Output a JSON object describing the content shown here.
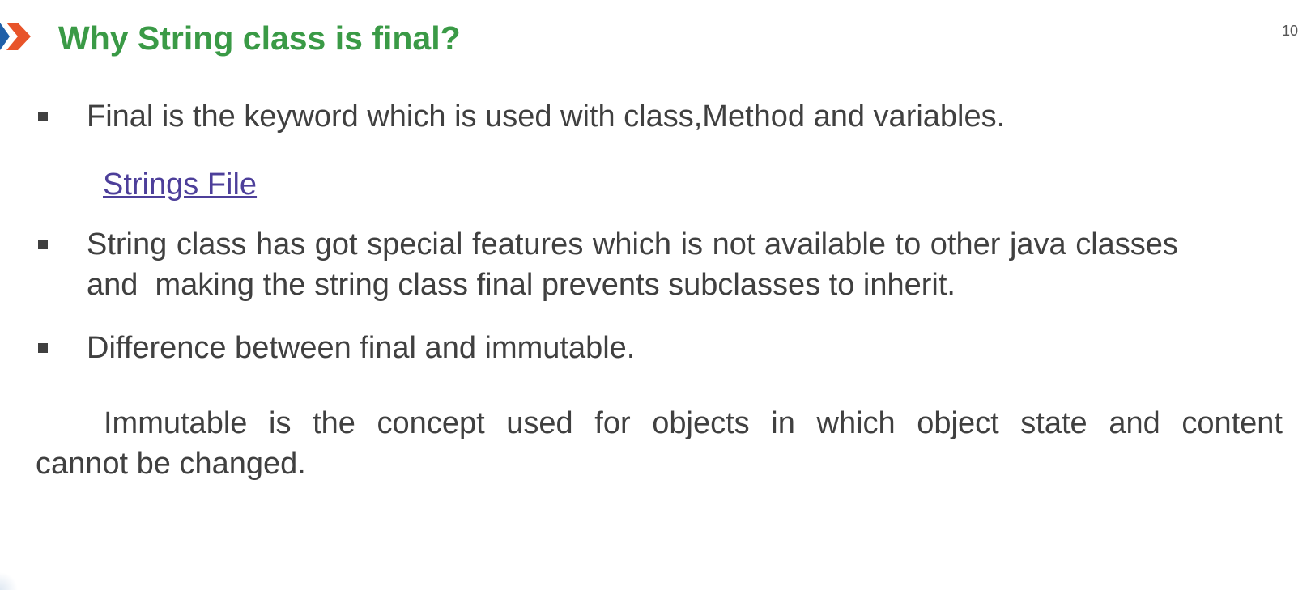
{
  "slide": {
    "title": "Why String class is final?",
    "number": "10",
    "logo_icon": "double-chevron-logo-icon",
    "colors": {
      "title": "#3a9a46",
      "body_text": "#404040",
      "link": "#4d3f9a",
      "logo_blue": "#1f5fa8",
      "logo_orange": "#e8542a"
    }
  },
  "bullets": [
    {
      "text": "Final is the keyword which is used with class,Method and variables."
    },
    {
      "text_line1": "String class has got special features which is not available to other java classes",
      "text_line2": "and  making the string class final prevents subclasses to inherit."
    },
    {
      "text": "Difference between final and immutable."
    }
  ],
  "link": {
    "label": "Strings File"
  },
  "paragraph": {
    "line1": "Immutable is the concept used for objects in which object state and content",
    "line2": "cannot be changed."
  }
}
